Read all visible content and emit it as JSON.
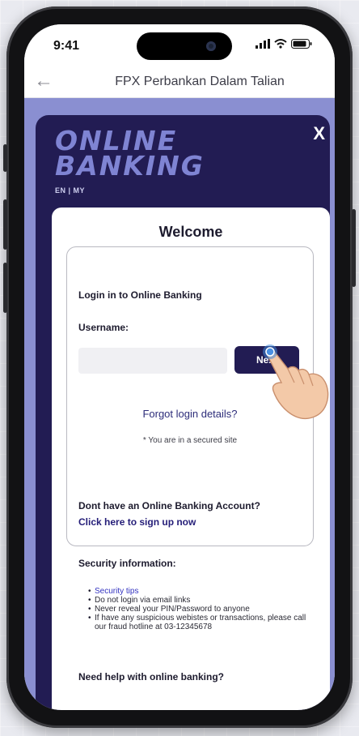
{
  "status_bar": {
    "time": "9:41"
  },
  "nav": {
    "back_icon": "back-arrow-icon",
    "title": "FPX Perbankan Dalam Talian"
  },
  "modal": {
    "brand_line1": "ONLINE",
    "brand_line2": "BANKING",
    "language": "EN | MY",
    "close_label": "X",
    "colors": {
      "modal_bg": "#221c53",
      "brand": "#7f84d3",
      "page_bg": "#8a8fd1"
    }
  },
  "login": {
    "welcome": "Welcome",
    "heading": "Login in to Online Banking",
    "username_label": "Username:",
    "username_value": "",
    "next_label": "Next",
    "forgot_label": "Forgot login details?",
    "secured_note": "* You are in a secured site",
    "no_account": "Dont have an Online Banking Account?",
    "signup_label": "Click here to sign up now"
  },
  "security": {
    "title": "Security information:",
    "items": [
      "Security tips",
      "Do not login via email links",
      "Never reveal your PIN/Password to anyone",
      "If have any suspicious webistes or transactions, please call our fraud hotline at 03-12345678"
    ],
    "help_title": "Need help with online banking?"
  }
}
